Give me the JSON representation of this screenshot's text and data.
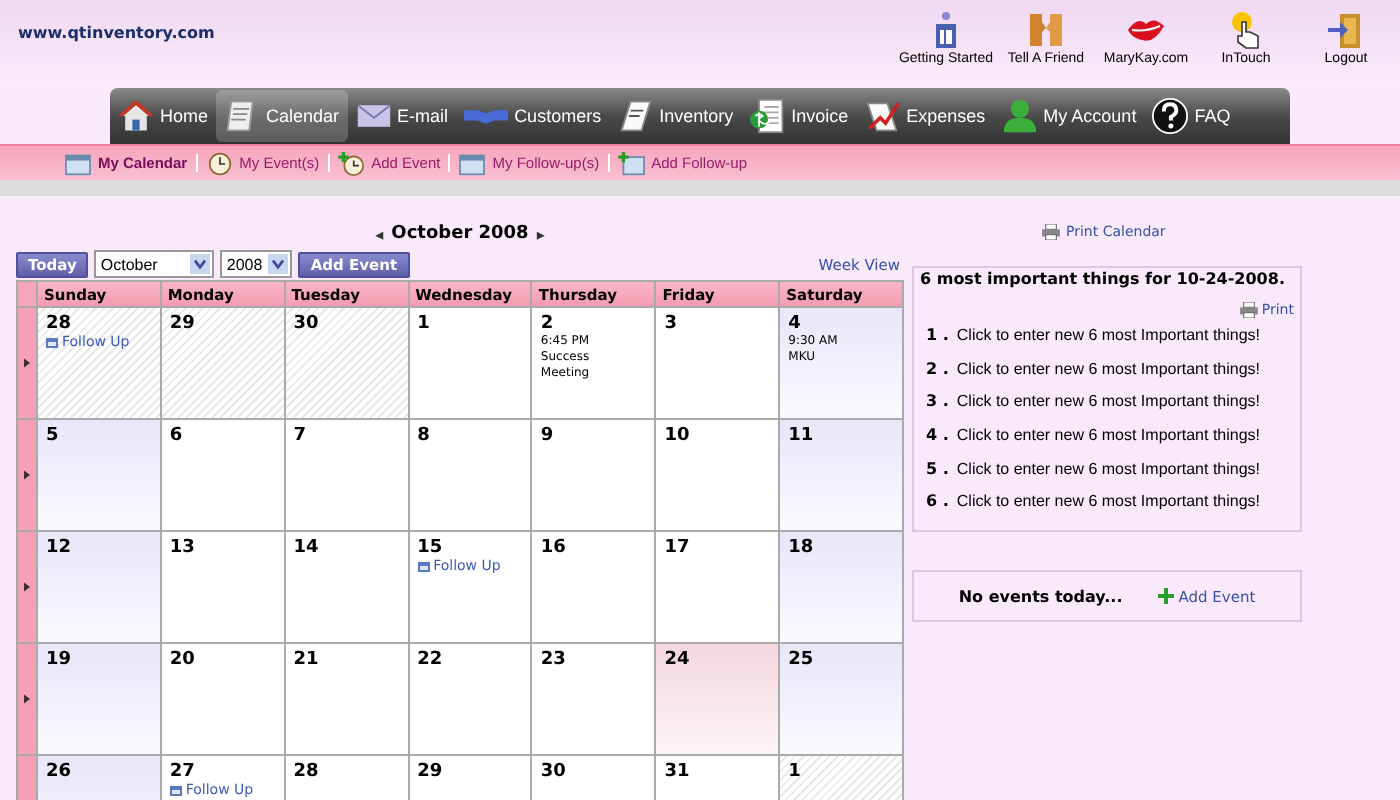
{
  "site": {
    "url": "www.qtinventory.com"
  },
  "top_links": [
    {
      "kind": "start",
      "label": "Getting Started"
    },
    {
      "kind": "friend",
      "label": "Tell A Friend"
    },
    {
      "kind": "lips",
      "label": "MaryKay.com"
    },
    {
      "kind": "touch",
      "label": "InTouch"
    },
    {
      "kind": "logout",
      "label": "Logout"
    }
  ],
  "nav": [
    {
      "kind": "home",
      "label": "Home",
      "selected": false
    },
    {
      "kind": "calendar",
      "label": "Calendar",
      "selected": true
    },
    {
      "kind": "email",
      "label": "E-mail",
      "selected": false
    },
    {
      "kind": "customers",
      "label": "Customers",
      "selected": false
    },
    {
      "kind": "inventory",
      "label": "Inventory",
      "selected": false
    },
    {
      "kind": "invoice",
      "label": "Invoice",
      "selected": false
    },
    {
      "kind": "expenses",
      "label": "Expenses",
      "selected": false
    },
    {
      "kind": "account",
      "label": "My Account",
      "selected": false
    },
    {
      "kind": "faq",
      "label": "FAQ",
      "selected": false
    }
  ],
  "subnav": [
    {
      "kind": "calendar",
      "label": "My Calendar",
      "selected": true
    },
    {
      "kind": "clock",
      "label": "My Event(s)",
      "selected": false
    },
    {
      "kind": "add-clock",
      "label": "Add Event",
      "selected": false
    },
    {
      "kind": "calendar",
      "label": "My Follow-up(s)",
      "selected": false
    },
    {
      "kind": "add-calendar",
      "label": "Add Follow-up",
      "selected": false
    }
  ],
  "calendar": {
    "prev": "◂",
    "title": "October 2008",
    "next": "▸",
    "today_button": "Today",
    "month": "October",
    "year": "2008",
    "add_event_button": "Add Event",
    "week_view": "Week View",
    "weekdays": [
      "Sunday",
      "Monday",
      "Tuesday",
      "Wednesday",
      "Thursday",
      "Friday",
      "Saturday"
    ],
    "weeks": [
      [
        {
          "date": "28",
          "kind": "outside",
          "events": [
            {
              "kind": "followup",
              "label": "Follow Up"
            }
          ]
        },
        {
          "date": "29",
          "kind": "outside"
        },
        {
          "date": "30",
          "kind": "outside"
        },
        {
          "date": "1",
          "kind": "weekday"
        },
        {
          "date": "2",
          "kind": "weekday",
          "events": [
            {
              "kind": "appointment",
              "time": "6:45 PM",
              "title": "Success Meeting"
            }
          ]
        },
        {
          "date": "3",
          "kind": "weekday"
        },
        {
          "date": "4",
          "kind": "weekend",
          "events": [
            {
              "kind": "appointment",
              "time": "9:30 AM",
              "title": "MKU"
            }
          ]
        }
      ],
      [
        {
          "date": "5",
          "kind": "weekend"
        },
        {
          "date": "6",
          "kind": "weekday"
        },
        {
          "date": "7",
          "kind": "weekday"
        },
        {
          "date": "8",
          "kind": "weekday"
        },
        {
          "date": "9",
          "kind": "weekday"
        },
        {
          "date": "10",
          "kind": "weekday"
        },
        {
          "date": "11",
          "kind": "weekend"
        }
      ],
      [
        {
          "date": "12",
          "kind": "weekend"
        },
        {
          "date": "13",
          "kind": "weekday"
        },
        {
          "date": "14",
          "kind": "weekday"
        },
        {
          "date": "15",
          "kind": "weekday",
          "events": [
            {
              "kind": "followup",
              "label": "Follow Up"
            }
          ]
        },
        {
          "date": "16",
          "kind": "weekday"
        },
        {
          "date": "17",
          "kind": "weekday"
        },
        {
          "date": "18",
          "kind": "weekend"
        }
      ],
      [
        {
          "date": "19",
          "kind": "weekend"
        },
        {
          "date": "20",
          "kind": "weekday"
        },
        {
          "date": "21",
          "kind": "weekday"
        },
        {
          "date": "22",
          "kind": "weekday"
        },
        {
          "date": "23",
          "kind": "weekday"
        },
        {
          "date": "24",
          "kind": "today"
        },
        {
          "date": "25",
          "kind": "weekend"
        }
      ],
      [
        {
          "date": "26",
          "kind": "weekend"
        },
        {
          "date": "27",
          "kind": "weekday",
          "events": [
            {
              "kind": "followup",
              "label": "Follow Up"
            }
          ]
        },
        {
          "date": "28",
          "kind": "weekday"
        },
        {
          "date": "29",
          "kind": "weekday"
        },
        {
          "date": "30",
          "kind": "weekday"
        },
        {
          "date": "31",
          "kind": "weekday"
        },
        {
          "date": "1",
          "kind": "outside"
        }
      ]
    ]
  },
  "sidebar": {
    "print_calendar": "Print Calendar",
    "important": {
      "title": "6 most important things for 10-24-2008.",
      "print": "Print",
      "items": [
        {
          "number": "1 .",
          "text": "Click to enter new 6 most Important things!"
        },
        {
          "number": "2 .",
          "text": "Click to enter new 6 most Important things!"
        },
        {
          "number": "3 .",
          "text": "Click to enter new 6 most Important things!"
        },
        {
          "number": "4 .",
          "text": "Click to enter new 6 most Important things!"
        },
        {
          "number": "5 .",
          "text": "Click to enter new 6 most Important things!"
        },
        {
          "number": "6 .",
          "text": "Click to enter new 6 most Important things!"
        }
      ]
    },
    "events": {
      "empty": "No events today...",
      "add": "Add Event"
    }
  }
}
